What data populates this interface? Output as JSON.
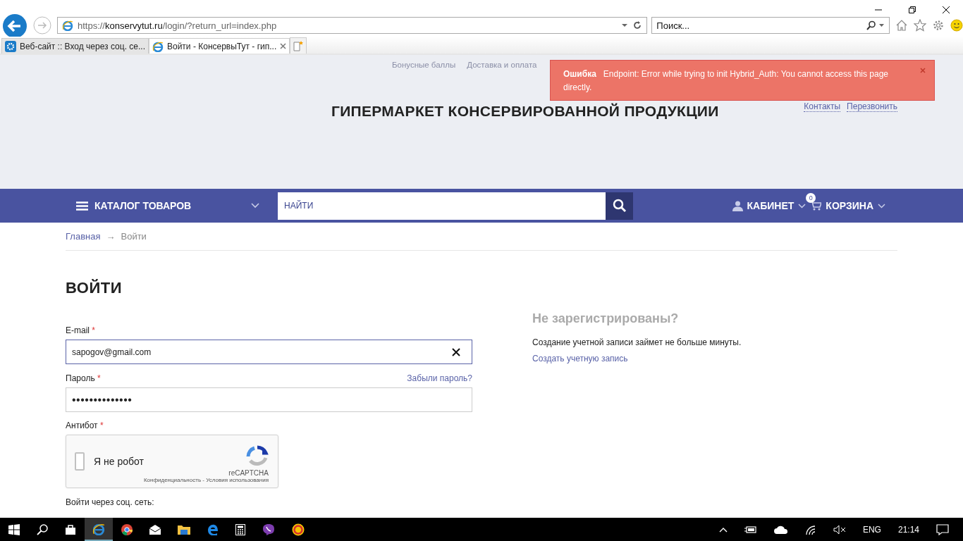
{
  "browser": {
    "url_prefix": "https://",
    "url_host": "konservytut.ru",
    "url_path": "/login/?return_url=index.php",
    "search_placeholder": "Поиск...",
    "tabs": [
      {
        "label": "Веб-сайт :: Вход через соц. се...",
        "selected": false,
        "kind": "gear"
      },
      {
        "label": "Войти - КонсервыТут - гип...",
        "selected": true,
        "kind": "ie"
      }
    ]
  },
  "header": {
    "top_links": [
      "Бонусные баллы",
      "Доставка и оплата"
    ],
    "title": "ГИПЕРМАРКЕТ КОНСЕРВИРОВАННОЙ ПРОДУКЦИИ",
    "contact_links": [
      "Контакты",
      "Перезвонить"
    ]
  },
  "toast": {
    "title": "Ошибка",
    "message": "Endpoint: Error while trying to init Hybrid_Auth: You cannot access this page directly."
  },
  "navbar": {
    "catalog": "КАТАЛОГ ТОВАРОВ",
    "search_placeholder": "НАЙТИ",
    "cabinet": "КАБИНЕТ",
    "cart": "КОРЗИНА",
    "cart_count": "0"
  },
  "breadcrumbs": [
    {
      "label": "Главная",
      "link": true
    },
    {
      "label": "Войти",
      "link": false
    }
  ],
  "breadcrumb_separator": "→",
  "login": {
    "title": "ВОЙТИ",
    "email_label": "E-mail",
    "email_value": "sapogov@gmail.com",
    "password_label": "Пароль",
    "password_value": "••••••••••••••",
    "forgot": "Забыли пароль?",
    "required_mark": "*",
    "antibot_label": "Антибот",
    "captcha": {
      "label": "Я не робот",
      "checked": false,
      "brand": "reCAPTCHA",
      "privacy": "Конфиденциальность",
      "separator": "-",
      "terms": "Условия использования"
    },
    "social_label": "Войти через соц. сеть:"
  },
  "register": {
    "title": "Не зарегистрированы?",
    "text": "Создание учетной записи займет не больше минуты.",
    "link": "Создать учетную запись"
  },
  "taskbar": {
    "lang": "ENG",
    "time": "21:14"
  }
}
